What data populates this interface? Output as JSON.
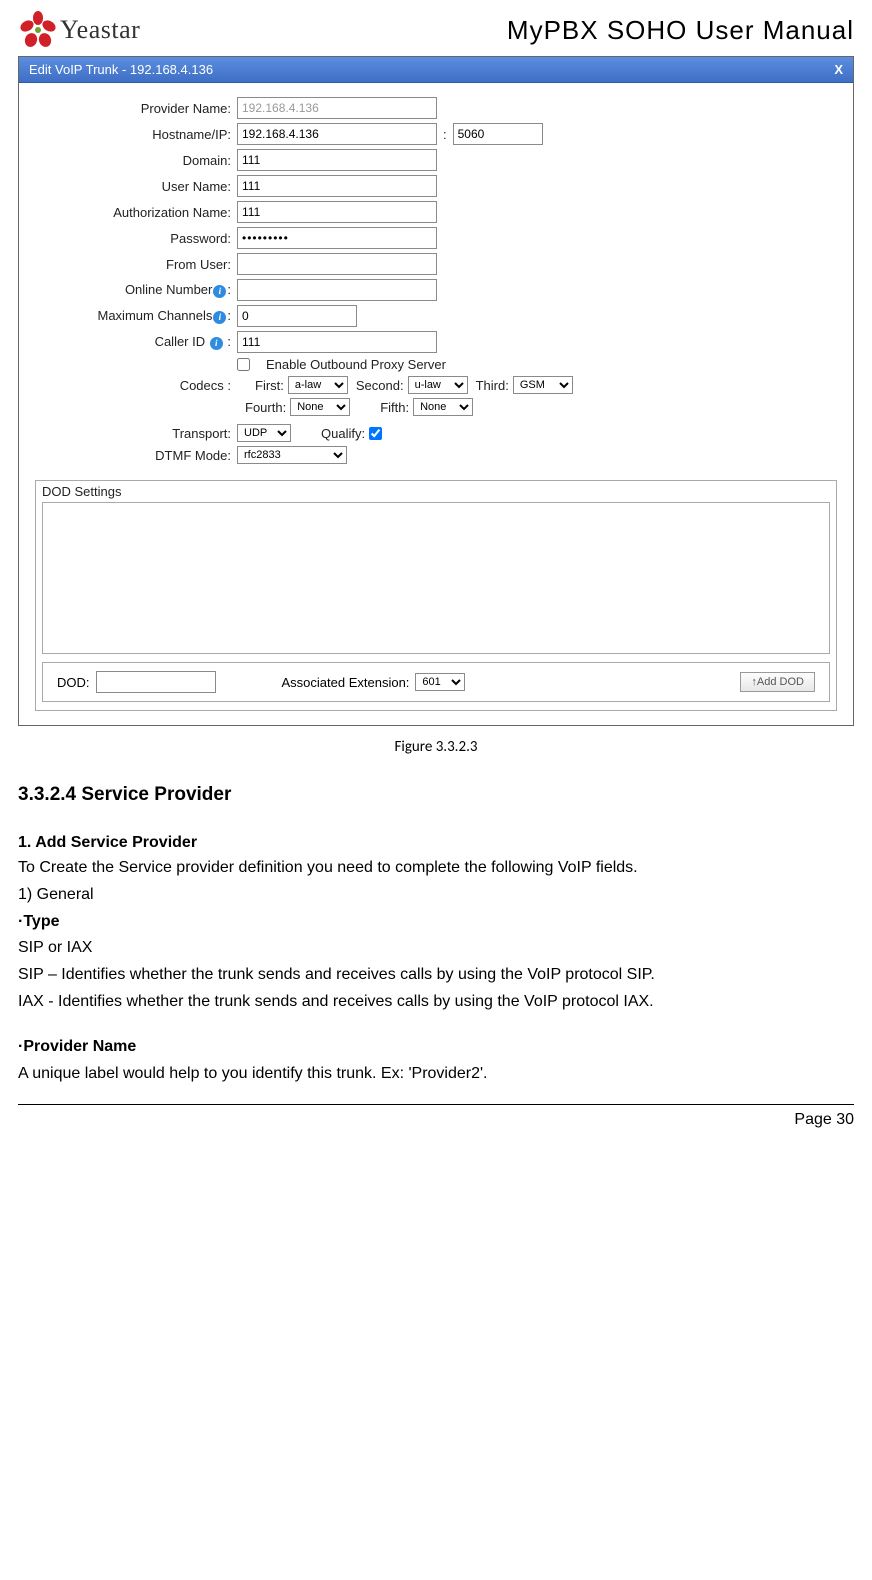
{
  "header": {
    "brand": "Yeastar",
    "doc_title": "MyPBX SOHO User Manual"
  },
  "dlg": {
    "title": "Edit VoIP Trunk - 192.168.4.136",
    "close": "X",
    "labels": {
      "provider_name": "Provider Name:",
      "hostname": "Hostname/IP:",
      "domain": "Domain:",
      "user_name": "User Name:",
      "auth_name": "Authorization Name:",
      "password": "Password:",
      "from_user": "From User:",
      "online_number": "Online Number",
      "max_channels": "Maximum Channels",
      "caller_id": "Caller ID",
      "enable_proxy": "Enable Outbound Proxy Server",
      "codecs": "Codecs :",
      "first": "First:",
      "second": "Second:",
      "third": "Third:",
      "fourth": "Fourth:",
      "fifth": "Fifth:",
      "transport": "Transport:",
      "qualify": "Qualify:",
      "dtmf": "DTMF Mode:",
      "dod_settings": "DOD Settings",
      "dod": "DOD:",
      "assoc_ext": "Associated Extension:",
      "add_dod": "↑Add DOD"
    },
    "values": {
      "provider_name": "192.168.4.136",
      "hostname": "192.168.4.136",
      "port": "5060",
      "domain": "111",
      "user_name": "111",
      "auth_name": "111",
      "password": "•••••••••",
      "from_user": "",
      "online_number": "",
      "max_channels": "0",
      "caller_id": "111",
      "codec1": "a-law",
      "codec2": "u-law",
      "codec3": "GSM",
      "codec4": "None",
      "codec5": "None",
      "transport": "UDP",
      "dtmf": "rfc2833",
      "assoc_ext": "601"
    }
  },
  "caption": "Figure 3.3.2.3",
  "section": {
    "heading": "3.3.2.4 Service Provider",
    "sub1": "1. Add Service Provider",
    "p1": "To Create the Service provider definition you need to complete the following VoIP fields.",
    "p2": "1)  General",
    "type_label": "·Type",
    "type_line": "SIP or IAX",
    "sip_line": "SIP – Identifies whether the trunk sends and receives calls by using the VoIP protocol SIP.",
    "iax_line": "IAX - Identifies whether the trunk sends and receives calls by using the VoIP protocol IAX.",
    "provider_label": "·Provider Name",
    "provider_line": "A unique label would help to you identify this trunk. Ex: 'Provider2'."
  },
  "footer": {
    "page": "Page 30"
  }
}
